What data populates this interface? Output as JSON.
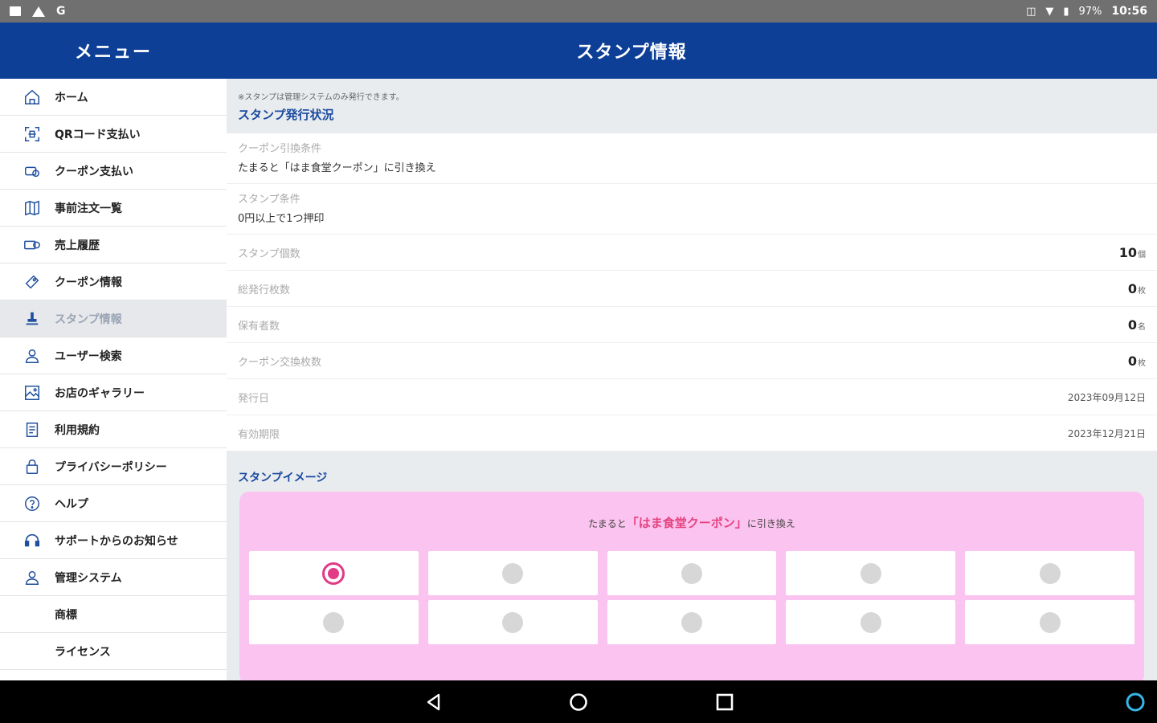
{
  "status_bar": {
    "left_icons": [
      "notification-icon",
      "warning-icon",
      "google-icon"
    ],
    "left_text": "G",
    "battery": "97%",
    "time": "10:56"
  },
  "header": {
    "menu_title": "メニュー",
    "page_title": "スタンプ情報"
  },
  "sidebar": {
    "items": [
      {
        "label": "ホーム",
        "icon": "home-icon"
      },
      {
        "label": "QRコード支払い",
        "icon": "qr-scan-icon"
      },
      {
        "label": "クーポン支払い",
        "icon": "coupon-pay-icon"
      },
      {
        "label": "事前注文一覧",
        "icon": "map-icon"
      },
      {
        "label": "売上履歴",
        "icon": "sales-icon"
      },
      {
        "label": "クーポン情報",
        "icon": "coupon-icon"
      },
      {
        "label": "スタンプ情報",
        "icon": "stamp-icon",
        "active": true
      },
      {
        "label": "ユーザー検索",
        "icon": "user-search-icon"
      },
      {
        "label": "お店のギャラリー",
        "icon": "gallery-icon"
      },
      {
        "label": "利用規約",
        "icon": "terms-icon"
      },
      {
        "label": "プライバシーポリシー",
        "icon": "lock-icon"
      },
      {
        "label": "ヘルプ",
        "icon": "help-icon"
      },
      {
        "label": "サポートからのお知らせ",
        "icon": "headset-icon"
      },
      {
        "label": "管理システム",
        "icon": "person-icon"
      },
      {
        "label": "商標",
        "icon": ""
      },
      {
        "label": "ライセンス",
        "icon": ""
      }
    ]
  },
  "main": {
    "notice": "※スタンプは管理システムのみ発行できます。",
    "issue_section_title": "スタンプ発行状況",
    "coupon_condition_label": "クーポン引換条件",
    "coupon_condition_value": "たまると「はま食堂クーポン」に引き換え",
    "stamp_condition_label": "スタンプ条件",
    "stamp_condition_value": "0円以上で1つ押印",
    "rows": [
      {
        "label": "スタンプ個数",
        "value": "10",
        "unit": "個"
      },
      {
        "label": "総発行枚数",
        "value": "0",
        "unit": "枚"
      },
      {
        "label": "保有者数",
        "value": "0",
        "unit": "名"
      },
      {
        "label": "クーポン交換枚数",
        "value": "0",
        "unit": "枚"
      },
      {
        "label": "発行日",
        "value": "2023年09月12日",
        "unit": ""
      },
      {
        "label": "有効期限",
        "value": "2023年12月21日",
        "unit": ""
      }
    ],
    "image_section_title": "スタンプイメージ",
    "stamp_card": {
      "caption_prefix": "たまると",
      "caption_highlight": "「はま食堂クーポン」",
      "caption_suffix": "に引き換え",
      "total": 10,
      "stamped": 1
    }
  },
  "navbar": {
    "buttons": [
      "back-icon",
      "home-circle-icon",
      "recents-icon",
      "assistant-icon"
    ]
  },
  "colors": {
    "header": "#0d3f96",
    "accent_text": "#1a4aa0",
    "stamp_card": "#fbc3ef",
    "stamp_mark": "#e23a86"
  }
}
